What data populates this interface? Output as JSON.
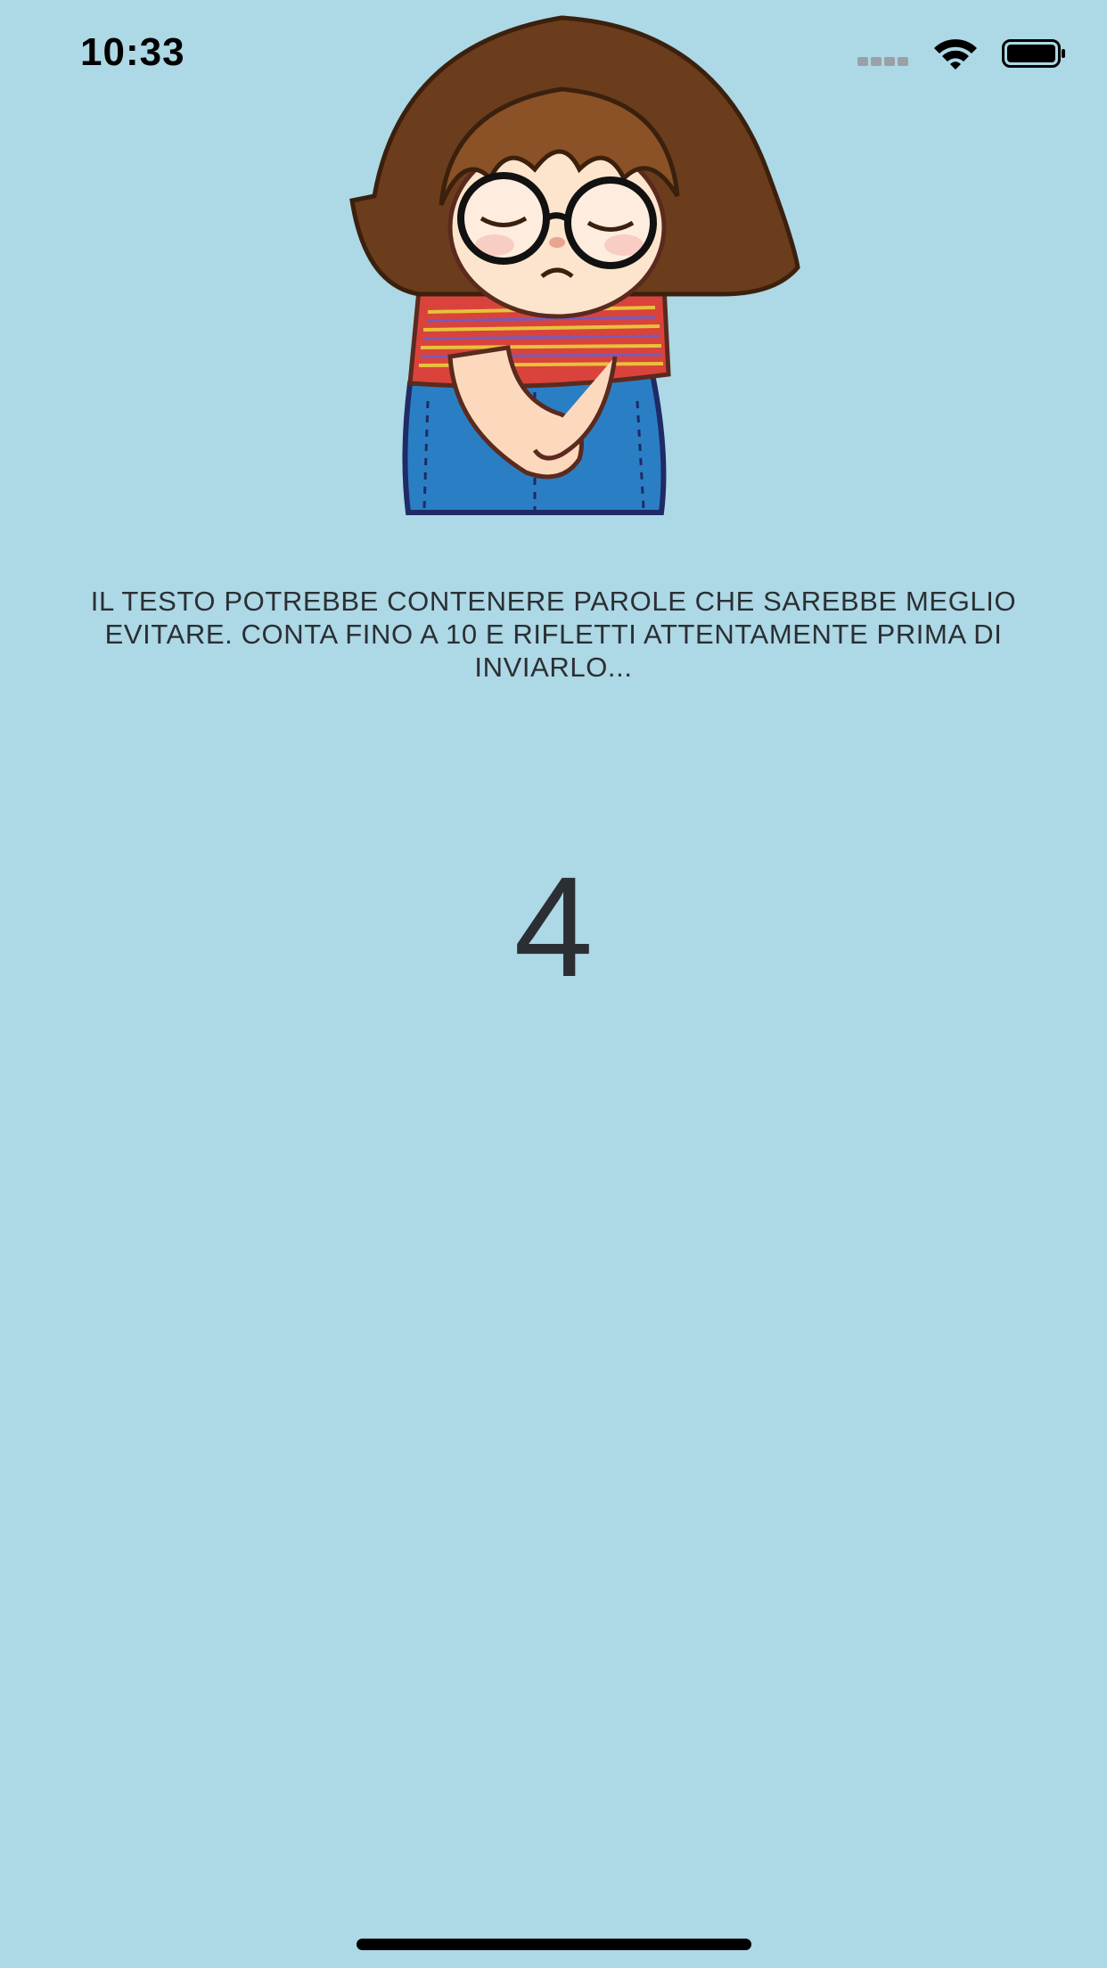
{
  "status_bar": {
    "time": "10:33"
  },
  "illustration": {
    "icon": "sad-girl-illustration"
  },
  "message": {
    "text": "IL TESTO POTREBBE CONTENERE PAROLE CHE SAREBBE MEGLIO EVITARE. CONTA FINO A 10 E RIFLETTI ATTENTAMENTE PRIMA DI INVIARLO..."
  },
  "countdown": {
    "value": "4"
  },
  "colors": {
    "background": "#add8e6",
    "text": "#2b2f33"
  }
}
